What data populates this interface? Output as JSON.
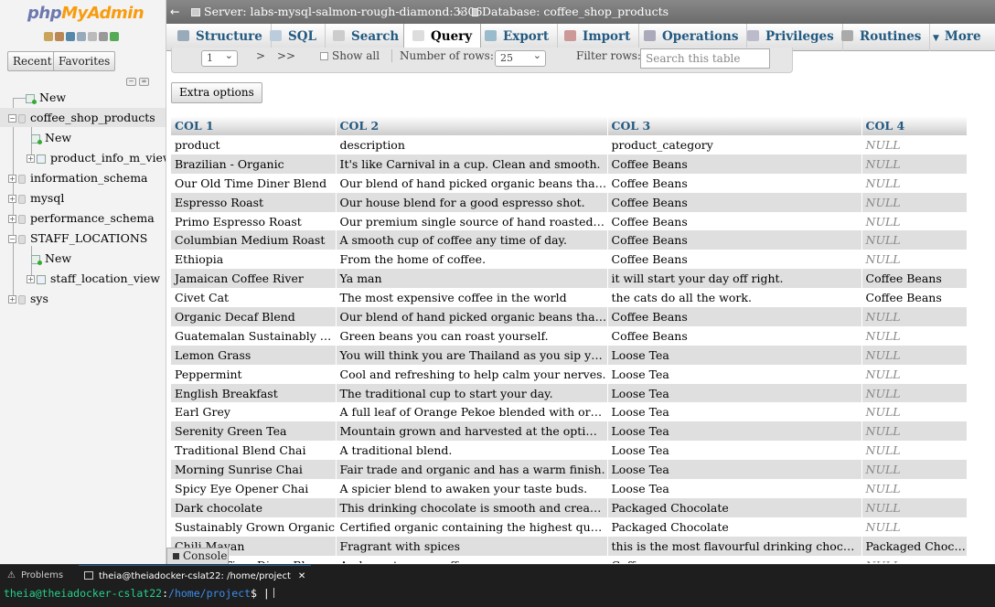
{
  "logo": {
    "part1": "php",
    "part2": "MyAdmin"
  },
  "nav_buttons": {
    "recent": "Recent",
    "favorites": "Favorites"
  },
  "tree": {
    "new_root": "New",
    "db1": "coffee_shop_products",
    "db1_new": "New",
    "db1_view": "product_info_m_view",
    "db2": "information_schema",
    "db3": "mysql",
    "db4": "performance_schema",
    "db5": "STAFF_LOCATIONS",
    "db5_new": "New",
    "db5_view": "staff_location_view",
    "db6": "sys"
  },
  "breadcrumb": {
    "back": "←",
    "server": "Server: labs-mysql-salmon-rough-diamond:3306",
    "sep": "»",
    "database": "Database: coffee_shop_products"
  },
  "tabs": {
    "structure": "Structure",
    "sql": "SQL",
    "search": "Search",
    "query": "Query",
    "export": "Export",
    "import": "Import",
    "operations": "Operations",
    "privileges": "Privileges",
    "routines": "Routines",
    "more": "More"
  },
  "navrow": {
    "page": "1",
    "next": ">",
    "last": ">>",
    "show_all": "Show all",
    "num_rows_label": "Number of rows:",
    "num_rows": "25",
    "filter_label": "Filter rows:",
    "filter_placeholder": "Search this table"
  },
  "extra_options": "Extra options",
  "table": {
    "headers": [
      "COL 1",
      "COL 2",
      "COL 3",
      "COL 4"
    ],
    "rows": [
      [
        "product",
        "description",
        "product_category",
        "NULL"
      ],
      [
        "Brazilian - Organic",
        "It's like Carnival in a cup. Clean and smooth.",
        "Coffee Beans",
        "NULL"
      ],
      [
        "Our Old Time Diner Blend",
        "Our blend of hand picked organic beans that rem...",
        "Coffee Beans",
        "NULL"
      ],
      [
        "Espresso Roast",
        "Our house blend for a good espresso shot.",
        "Coffee Beans",
        "NULL"
      ],
      [
        "Primo Espresso Roast",
        "Our premium single source of hand roasted beans.",
        "Coffee Beans",
        "NULL"
      ],
      [
        "Columbian Medium Roast",
        "A smooth cup of coffee any time of day.",
        "Coffee Beans",
        "NULL"
      ],
      [
        "Ethiopia",
        "From the home of coffee.",
        "Coffee Beans",
        "NULL"
      ],
      [
        "Jamaican Coffee River",
        "Ya man",
        " it will start your day off right.",
        "Coffee Beans"
      ],
      [
        "Civet Cat",
        "The most expensive coffee in the world",
        " the cats do all the work.",
        "Coffee Beans"
      ],
      [
        "Organic Decaf Blend",
        "Our blend of hand picked organic beans that have b...",
        "Coffee Beans",
        "NULL"
      ],
      [
        "Guatemalan Sustainably Grown",
        "Green beans you can roast yourself.",
        "Coffee Beans",
        "NULL"
      ],
      [
        "Lemon Grass",
        "You will think you are Thailand as you sip your cu...",
        "Loose Tea",
        "NULL"
      ],
      [
        "Peppermint",
        "Cool and refreshing to help calm your nerves.",
        "Loose Tea",
        "NULL"
      ],
      [
        "English Breakfast",
        "The traditional cup to start your day.",
        "Loose Tea",
        "NULL"
      ],
      [
        "Earl Grey",
        "A full leaf of Orange Pekoe blended with organic o...",
        "Loose Tea",
        "NULL"
      ],
      [
        "Serenity Green Tea",
        "Mountain grown and harvested at the optimal time.",
        "Loose Tea",
        "NULL"
      ],
      [
        "Traditional Blend Chai",
        "A traditional blend.",
        "Loose Tea",
        "NULL"
      ],
      [
        "Morning Sunrise Chai",
        "Fair trade and organic and has a warm finish.",
        "Loose Tea",
        "NULL"
      ],
      [
        "Spicy Eye Opener Chai",
        "A spicier blend to awaken your taste buds.",
        "Loose Tea",
        "NULL"
      ],
      [
        "Dark chocolate",
        "This drinking chocolate is smooth and creamy.",
        "Packaged Chocolate",
        "NULL"
      ],
      [
        "Sustainably Grown Organic",
        "Certified organic containing the highest quality i...",
        "Packaged Chocolate",
        "NULL"
      ],
      [
        "Chili Mayan",
        "Fragrant with spices",
        " this is the most flavourful drinking chocolate yo...",
        "Packaged Chocolate"
      ],
      [
        "Our Old Time Diner Blend Sm",
        "An honest cup a coffee",
        "Coffee",
        "NULL"
      ]
    ]
  },
  "console_label": "Console",
  "bottom_panel": {
    "problems": "Problems",
    "terminal_tab": "theia@theiadocker-cslat22: /home/project",
    "close": "✕"
  },
  "terminal": {
    "user": "theia@theiadocker-cslat22",
    "sep": ":",
    "path": "/home/project",
    "prompt": "$ |"
  },
  "colors": {
    "link_blue": "#235a81",
    "logo_php": "#6c78af",
    "logo_myadmin": "#f89c0e",
    "terminal_green": "#23d18b",
    "terminal_blue": "#3b8eea"
  }
}
